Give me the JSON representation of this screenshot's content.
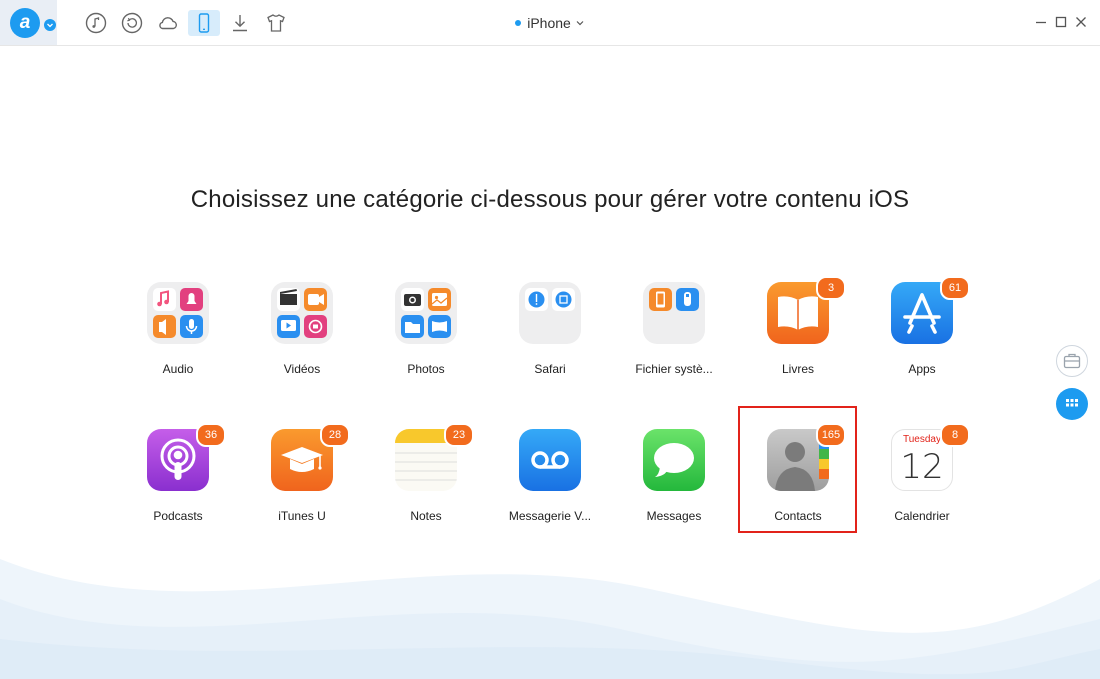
{
  "topbar": {
    "device_name": "iPhone",
    "nav_icons": [
      "music-icon",
      "restore-icon",
      "cloud-icon",
      "phone-icon",
      "download-icon",
      "shirt-icon"
    ]
  },
  "main": {
    "headline": "Choisissez une catégorie ci-dessous pour gérer votre contenu iOS"
  },
  "categories": [
    {
      "label": "Audio",
      "badge": ""
    },
    {
      "label": "Vidéos",
      "badge": ""
    },
    {
      "label": "Photos",
      "badge": ""
    },
    {
      "label": "Safari",
      "badge": ""
    },
    {
      "label": "Fichier systè...",
      "badge": ""
    },
    {
      "label": "Livres",
      "badge": "3"
    },
    {
      "label": "Apps",
      "badge": "61"
    },
    {
      "label": "Podcasts",
      "badge": "36"
    },
    {
      "label": "iTunes U",
      "badge": "28"
    },
    {
      "label": "Notes",
      "badge": "23"
    },
    {
      "label": "Messagerie V...",
      "badge": ""
    },
    {
      "label": "Messages",
      "badge": ""
    },
    {
      "label": "Contacts",
      "badge": "165"
    },
    {
      "label": "Calendrier",
      "badge": "8"
    }
  ],
  "calendar_icon": {
    "day_name": "Tuesday",
    "day_number": "12"
  },
  "colors": {
    "accent": "#1d9bf0",
    "badge": "#f26b1d",
    "highlight": "#e2231a"
  }
}
